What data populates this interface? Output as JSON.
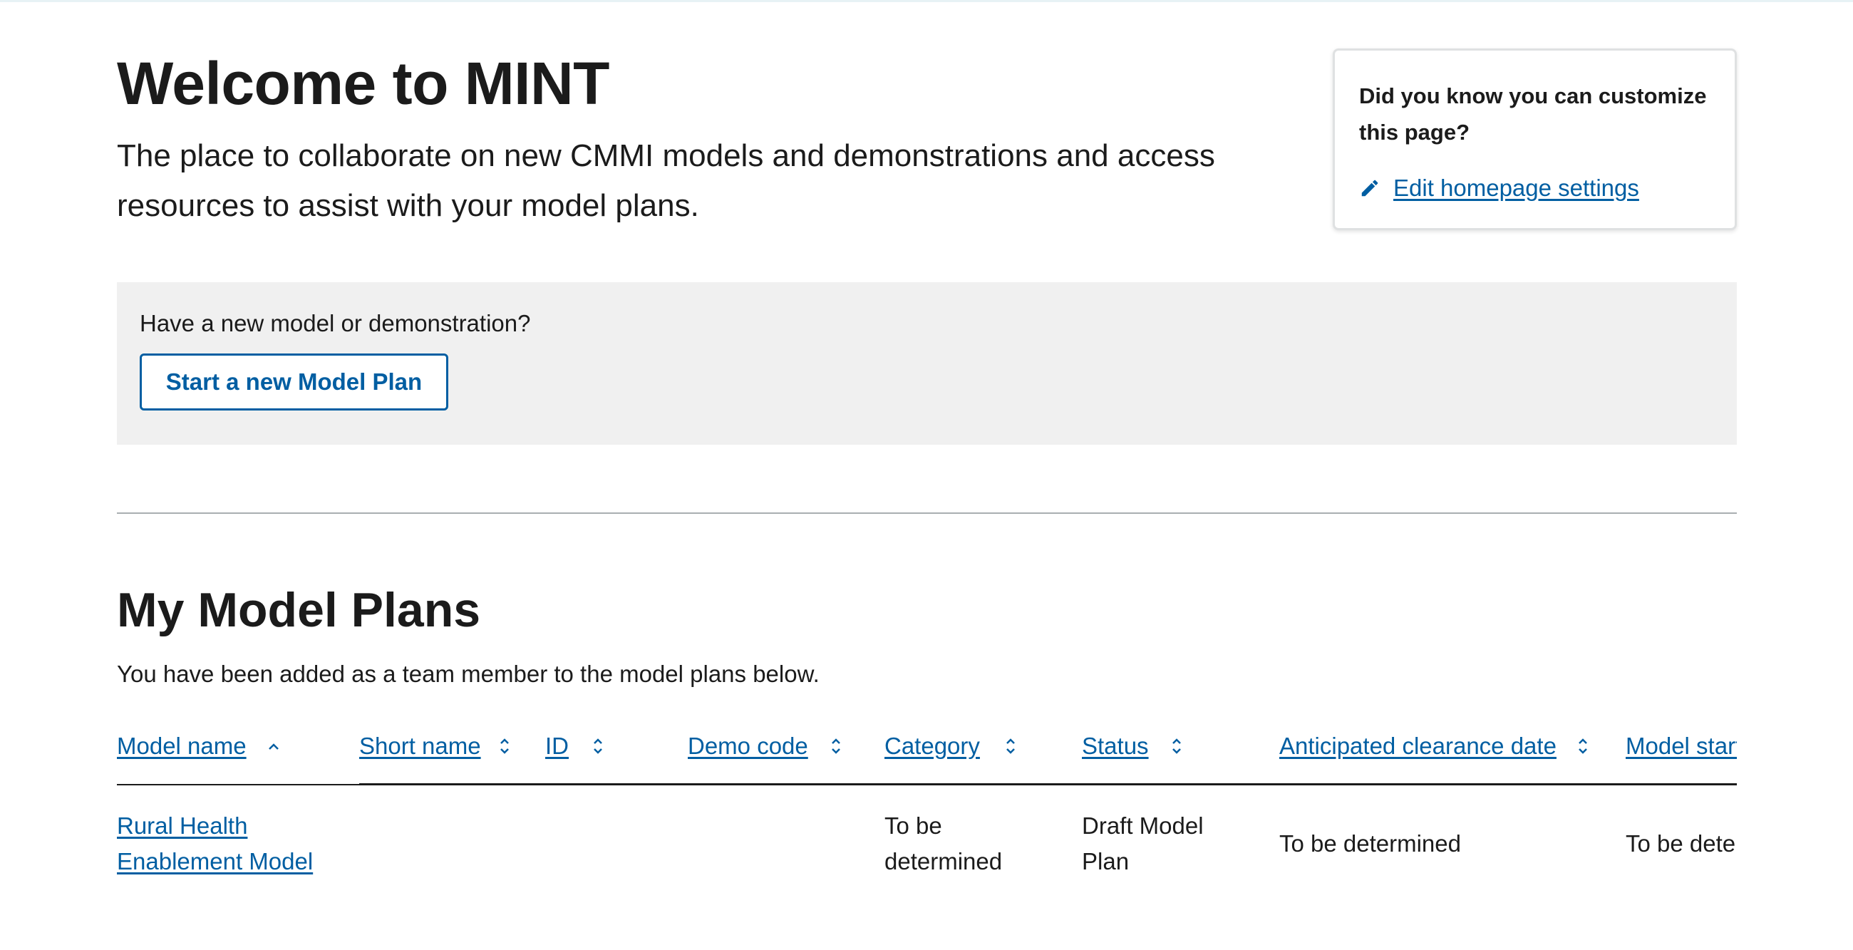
{
  "header": {
    "title": "Welcome to MINT",
    "subtitle": "The place to collaborate on new CMMI models and demonstrations and access resources to assist with your model plans."
  },
  "tip_card": {
    "title": "Did you know you can customize this page?",
    "link_label": "Edit homepage settings",
    "icon": "pencil-icon"
  },
  "cta": {
    "prompt": "Have a new model or demonstration?",
    "button_label": "Start a new Model Plan"
  },
  "my_model_plans": {
    "title": "My Model Plans",
    "description": "You have been added as a team member to the model plans below.",
    "columns": [
      {
        "label": "Model name",
        "sort": "ascending"
      },
      {
        "label": "Short name",
        "sort": "unsorted"
      },
      {
        "label": "ID",
        "sort": "unsorted"
      },
      {
        "label": "Demo code",
        "sort": "unsorted"
      },
      {
        "label": "Category",
        "sort": "unsorted"
      },
      {
        "label": "Status",
        "sort": "unsorted"
      },
      {
        "label": "Anticipated clearance date",
        "sort": "unsorted"
      },
      {
        "label": "Model start date",
        "sort": "unsorted"
      }
    ],
    "rows": [
      {
        "model_name": "Rural Health Enablement Model",
        "short_name": "",
        "id": "",
        "demo_code": "",
        "category": "To be determined",
        "status": "Draft Model Plan",
        "anticipated_clearance_date": "To be determined",
        "model_start_date": "To be determined"
      }
    ]
  },
  "colors": {
    "link": "#005ea2",
    "text": "#1b1b1b",
    "cta_background": "#f0f0f0",
    "card_border": "#dfe1e2"
  }
}
